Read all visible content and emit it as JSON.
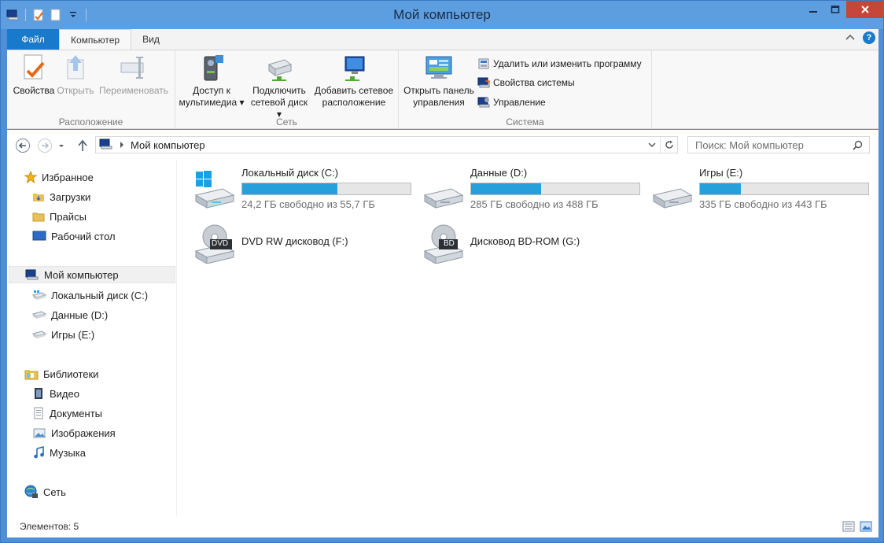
{
  "window": {
    "title": "Мой компьютер"
  },
  "ribbon_tabs": {
    "file": "Файл",
    "computer": "Компьютер",
    "view": "Вид"
  },
  "ribbon": {
    "location_group": {
      "label": "Расположение",
      "properties": "Свойства",
      "open": "Открыть",
      "rename": "Переименовать"
    },
    "network_group": {
      "label": "Сеть",
      "media_access_line1": "Доступ к",
      "media_access_line2": "мультимедиа",
      "map_drive_line1": "Подключить",
      "map_drive_line2": "сетевой диск",
      "add_location_line1": "Добавить сетевое",
      "add_location_line2": "расположение"
    },
    "system_group": {
      "label": "Система",
      "control_panel_line1": "Открыть панель",
      "control_panel_line2": "управления",
      "uninstall": "Удалить или изменить программу",
      "system_properties": "Свойства системы",
      "manage": "Управление"
    }
  },
  "address": {
    "path": "Мой компьютер",
    "search_placeholder": "Поиск: Мой компьютер"
  },
  "nav": {
    "favorites": "Избранное",
    "downloads": "Загрузки",
    "prices": "Прайсы",
    "desktop": "Рабочий стол",
    "computer": "Мой компьютер",
    "drive_c": "Локальный диск (C:)",
    "drive_d": "Данные (D:)",
    "drive_e": "Игры (E:)",
    "libraries": "Библиотеки",
    "video": "Видео",
    "documents": "Документы",
    "images": "Изображения",
    "music": "Музыка",
    "network": "Сеть"
  },
  "drives": [
    {
      "name": "Локальный диск (C:)",
      "free": "24,2 ГБ свободно из 55,7 ГБ",
      "used_fraction": 0.566
    },
    {
      "name": "Данные (D:)",
      "free": "285 ГБ свободно из 488 ГБ",
      "used_fraction": 0.416
    },
    {
      "name": "Игры (E:)",
      "free": "335 ГБ свободно из 443 ГБ",
      "used_fraction": 0.244
    }
  ],
  "optical": [
    {
      "name": "DVD RW дисковод (F:)",
      "badge": "DVD"
    },
    {
      "name": "Дисковод BD-ROM (G:)",
      "badge": "BD"
    }
  ],
  "status": {
    "items": "Элементов: 5"
  },
  "colors": {
    "accent": "#1979ca",
    "bar_fill": "#26a0da",
    "titlebar": "#5d9ee1",
    "close": "#c6463c"
  }
}
